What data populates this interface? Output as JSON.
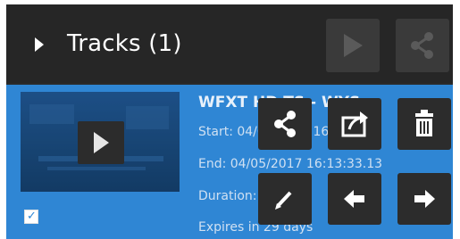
{
  "header": {
    "title": "Tracks (1)"
  },
  "track": {
    "title": "WFXT HD TS  - WYS",
    "start": "Start: 04/05/2017 16:43:",
    "end": "End: 04/05/2017 16:13:33.13",
    "duration": "Duration: 0:",
    "expires": "Expires in 29 days",
    "checked": true
  },
  "icons": {
    "expand": "caret-right-icon",
    "play": "play-icon",
    "share": "share-icon",
    "export": "export-icon",
    "delete": "trash-icon",
    "edit": "pencil-icon",
    "prev": "arrow-left-icon",
    "next": "arrow-right-icon"
  },
  "colors": {
    "header_bg": "#262626",
    "track_bg": "#2f86d4",
    "button_bg": "#2c2c2c"
  }
}
